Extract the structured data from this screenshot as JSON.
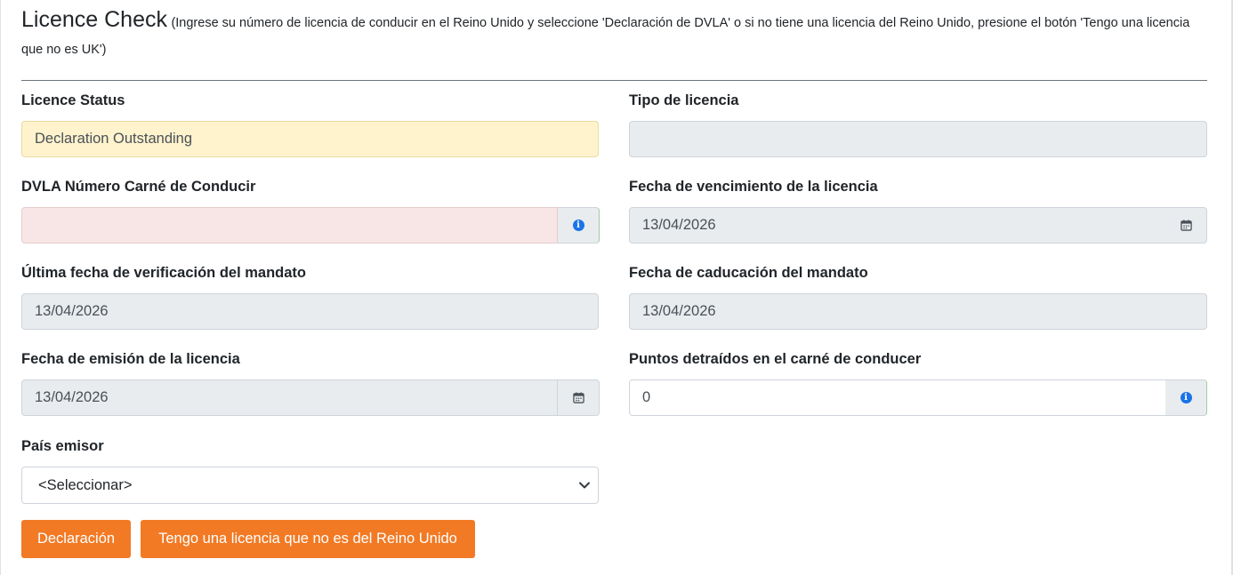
{
  "header": {
    "title": "Licence Check",
    "subtitle": "(Ingrese su número de licencia de conducir en el Reino Unido y seleccione 'Declaración de DVLA' o si no tiene una licencia del Reino Unido, presione el botón 'Tengo una licencia que no es UK')"
  },
  "fields": {
    "licence_status": {
      "label": "Licence Status",
      "value": "Declaration Outstanding"
    },
    "licence_type": {
      "label": "Tipo de licencia",
      "value": ""
    },
    "dvla_number": {
      "label": "DVLA Número Carné de Conducir",
      "value": ""
    },
    "licence_expiry": {
      "label": "Fecha de vencimiento de la licencia",
      "value": "13/04/2026"
    },
    "last_mandate_check": {
      "label": "Última fecha de verificación del mandato",
      "value": "13/04/2026"
    },
    "mandate_expiry": {
      "label": "Fecha de caducación del mandato",
      "value": "13/04/2026"
    },
    "licence_issue": {
      "label": "Fecha de emisión de la licencia",
      "value": "13/04/2026"
    },
    "points": {
      "label": "Puntos detraídos en el carné de conducer",
      "value": "0"
    },
    "issuing_country": {
      "label": "País emisor",
      "selected": "<Seleccionar>"
    }
  },
  "buttons": {
    "declaration": "Declaración",
    "non_uk": "Tengo una licencia que no es del Reino Unido"
  },
  "icons": {
    "info": "info-icon",
    "calendar": "calendar-icon",
    "dropdown": "chevron-down-icon"
  },
  "colors": {
    "accent": "#f27a25",
    "warning_bg": "#fff3cd",
    "danger_bg": "#f8e6e6",
    "readonly_bg": "#e9ecef",
    "info_blue": "#1a73e8"
  }
}
